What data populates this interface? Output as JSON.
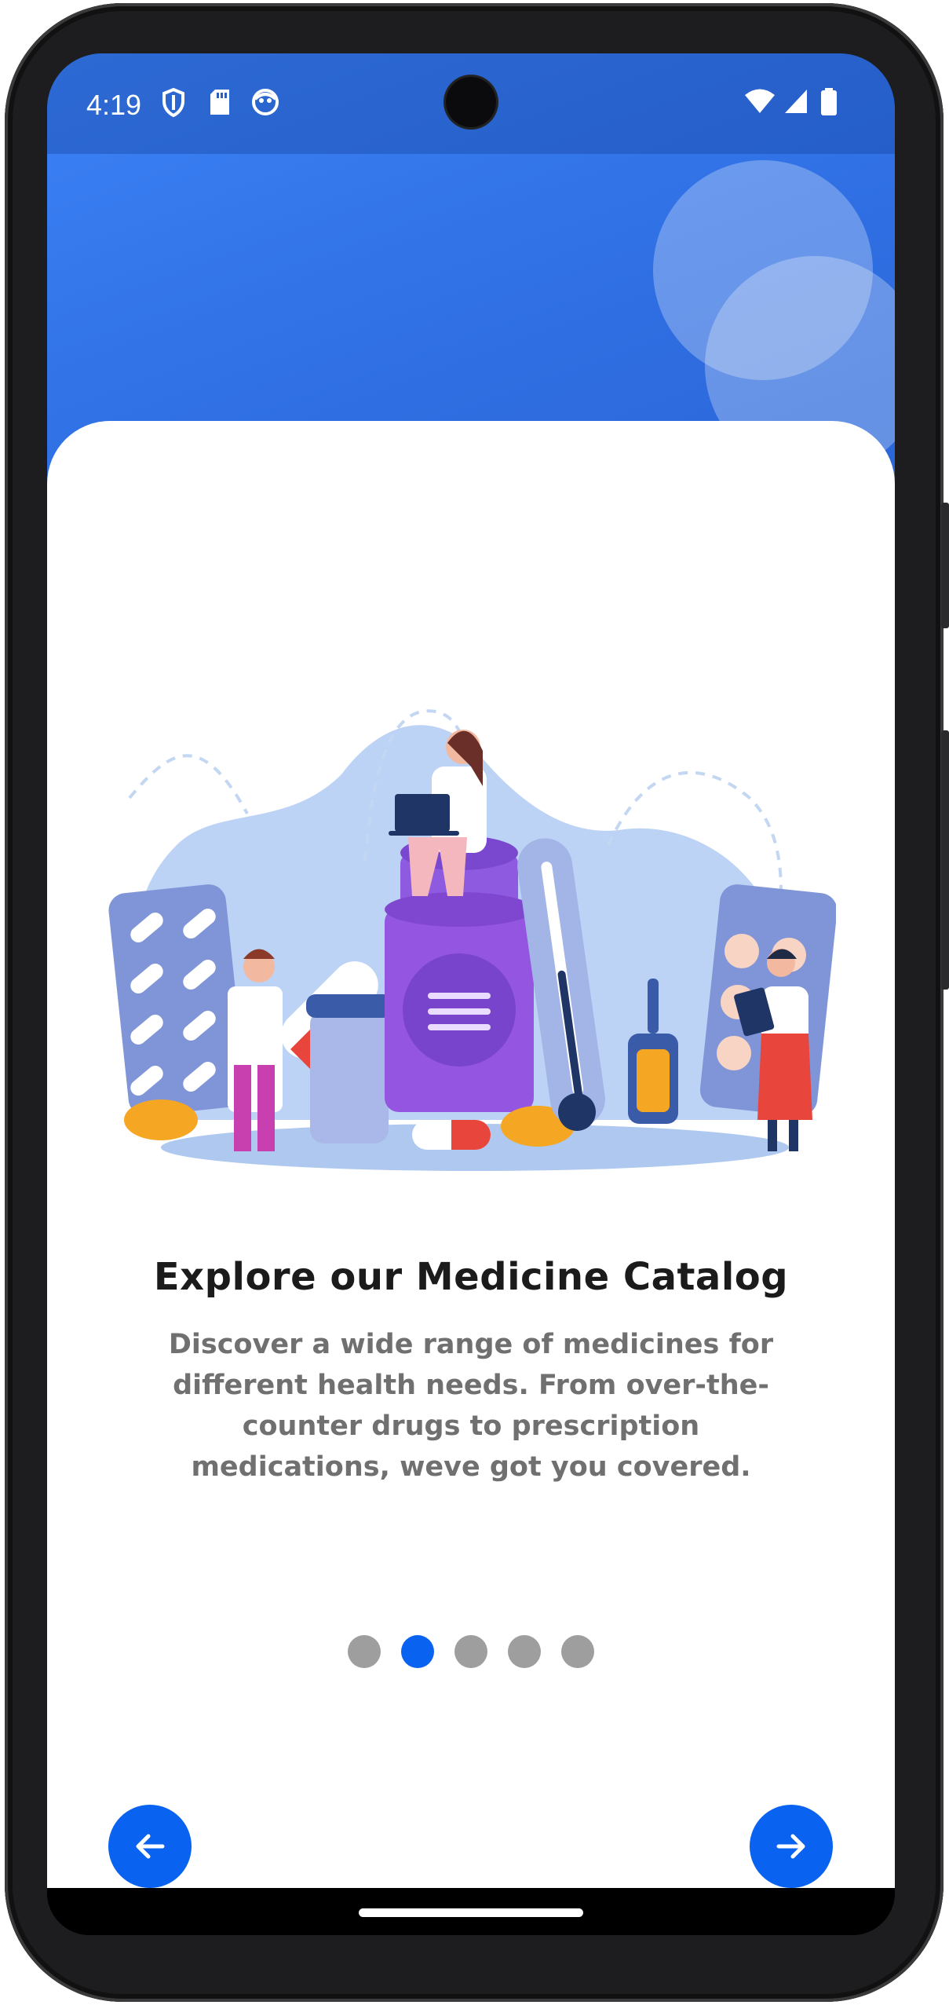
{
  "status_bar": {
    "time": "4:19",
    "left_icons": [
      "shield-icon",
      "sd-card-icon",
      "notification-app-icon"
    ],
    "right_icons": [
      "wifi-icon",
      "cell-signal-icon",
      "battery-icon"
    ]
  },
  "onboarding": {
    "title": "Explore our Medicine Catalog",
    "description": "Discover a wide range of medicines for different health needs. From over-the-counter drugs to prescription medications, weve got you covered.",
    "page_indicator": {
      "total": 5,
      "active_index": 1
    },
    "back_button_icon": "arrow-left-icon",
    "next_button_icon": "arrow-right-icon"
  },
  "colors": {
    "accent": "#0a63f0",
    "hero_blue": "#3b82f6",
    "dot_inactive": "#9e9e9e",
    "title": "#1b1b1b",
    "body_text": "#707070"
  }
}
